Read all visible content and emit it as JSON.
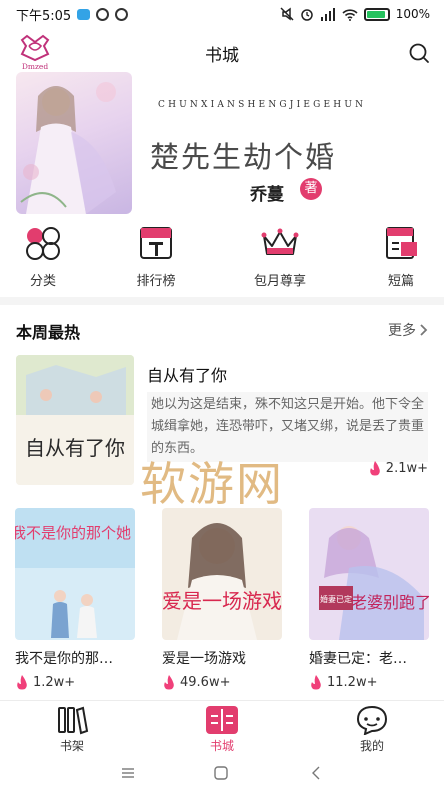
{
  "status_bar": {
    "time": "下午5:05",
    "battery": "100%"
  },
  "header": {
    "title": "书城",
    "logo_text": "Dmzed",
    "search_icon": "search-icon"
  },
  "banner": {
    "subtitle": "CHUNXIANSHENGJIEGEHUN",
    "title": "楚先生劫个婚",
    "author": "乔蔓",
    "author_badge": "著"
  },
  "categories": [
    {
      "label": "分类",
      "icon": "category-icon"
    },
    {
      "label": "排行榜",
      "icon": "ranking-icon"
    },
    {
      "label": "包月尊享",
      "icon": "crown-icon"
    },
    {
      "label": "短篇",
      "icon": "short-story-icon"
    }
  ],
  "section": {
    "title": "本周最热",
    "more": "更多"
  },
  "featured": {
    "title": "自从有了你",
    "cover_text": "自从有了你",
    "description": "她以为这是结束，殊不知这只是开始。他下令全城缉拿她，连恐带吓，又堵又绑，说是丢了贵重的东西。",
    "heat": "2.1w+"
  },
  "watermark": "软游网",
  "books": [
    {
      "title": "我不是你的那…",
      "cover_text": "我不是你的那个她",
      "heat": "1.2w+"
    },
    {
      "title": "爱是一场游戏",
      "cover_text": "爱是一场游戏",
      "heat": "49.6w+"
    },
    {
      "title": "婚妻已定：老…",
      "cover_text": "老婆别跑了",
      "cover_badge": "婚妻已定",
      "heat": "11.2w+"
    }
  ],
  "bottom_nav": [
    {
      "label": "书架",
      "icon": "bookshelf-icon",
      "active": false
    },
    {
      "label": "书城",
      "icon": "bookstore-icon",
      "active": true
    },
    {
      "label": "我的",
      "icon": "profile-icon",
      "active": false
    }
  ],
  "colors": {
    "accent": "#e23d6e",
    "flame": "#f0407a"
  }
}
